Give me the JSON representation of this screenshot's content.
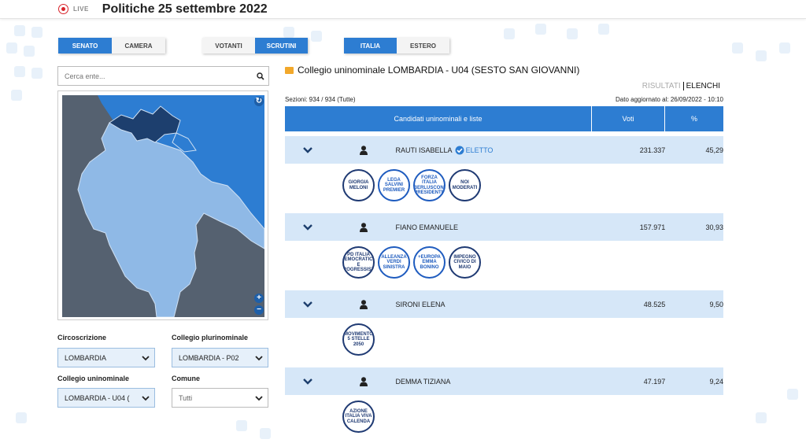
{
  "header": {
    "live_label": "LIVE",
    "title": "Politiche 25 settembre 2022"
  },
  "toggles": {
    "chamber": [
      {
        "label": "SENATO",
        "active": true
      },
      {
        "label": "CAMERA",
        "active": false
      }
    ],
    "mode": [
      {
        "label": "VOTANTI",
        "active": false
      },
      {
        "label": "SCRUTINI",
        "active": true
      }
    ],
    "area": [
      {
        "label": "ITALIA",
        "active": true
      },
      {
        "label": "ESTERO",
        "active": false
      }
    ]
  },
  "search": {
    "placeholder": "Cerca ente..."
  },
  "filters": {
    "circoscrizione_label": "Circoscrizione",
    "circoscrizione_value": "LOMBARDIA",
    "plurinominale_label": "Collegio plurinominale",
    "plurinominale_value": "LOMBARDIA - P02",
    "uninominale_label": "Collegio uninominale",
    "uninominale_value": "LOMBARDIA - U04 (",
    "comune_label": "Comune",
    "comune_value": "Tutti"
  },
  "results": {
    "collegio_title": "Collegio uninominale LOMBARDIA - U04 (SESTO SAN GIOVANNI)",
    "tab_risultati": "RISULTATI",
    "tab_elenchi": "ELENCHI",
    "sezioni": "Sezioni: 934 / 934 (Tutte)",
    "updated": "Dato aggiornato al: 26/09/2022 - 10:10",
    "col_candidates": "Candidati uninominali e liste",
    "col_votes": "Voti",
    "col_pct": "%",
    "elected_label": "ELETTO",
    "candidates": [
      {
        "name": "RAUTI ISABELLA",
        "elected": true,
        "votes": "231.337",
        "pct": "45,29",
        "lists": [
          "GIORGIA MELONI",
          "LEGA SALVINI PREMIER",
          "FORZA ITALIA BERLUSCONI PRESIDENTE",
          "NOI MODERATI"
        ]
      },
      {
        "name": "FIANO EMANUELE",
        "elected": false,
        "votes": "157.971",
        "pct": "30,93",
        "lists": [
          "PD ITALIA DEMOCRATICA E PROGRESSISTA",
          "ALLEANZA VERDI SINISTRA",
          "+EUROPA EMMA BONINO",
          "IMPEGNO CIVICO DI MAIO"
        ]
      },
      {
        "name": "SIRONI ELENA",
        "elected": false,
        "votes": "48.525",
        "pct": "9,50",
        "lists": [
          "MOVIMENTO 5 STELLE 2050"
        ]
      },
      {
        "name": "DEMMA TIZIANA",
        "elected": false,
        "votes": "47.197",
        "pct": "9,24",
        "lists": [
          "AZIONE ITALIA VIVA CALENDA"
        ]
      }
    ]
  },
  "colors": {
    "accent": "#2d7dd2",
    "row_bg": "#d6e7f8",
    "map_selected": "#1d3f6e",
    "map_area": "#8fb9e6",
    "map_other": "#556170"
  }
}
